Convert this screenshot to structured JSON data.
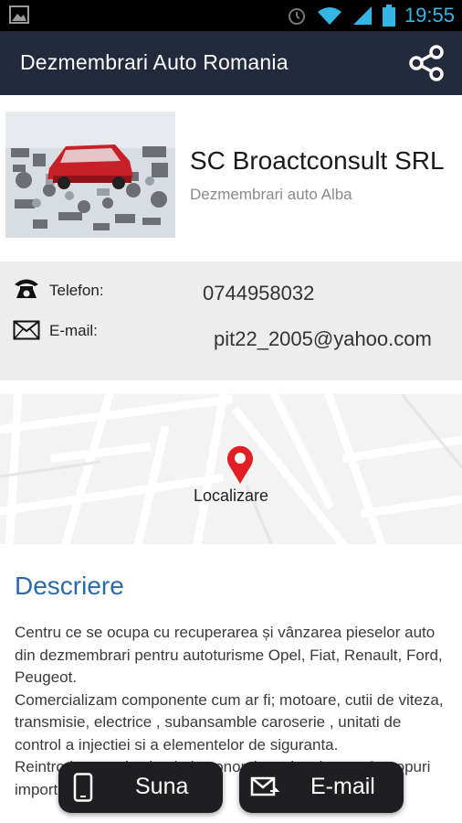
{
  "status_bar": {
    "time": "19:55",
    "icons": [
      "image-icon",
      "alarm-icon",
      "wifi-icon",
      "signal-icon",
      "battery-icon"
    ],
    "accent": "#33b5e5"
  },
  "toolbar": {
    "title": "Dezmembrari Auto Romania",
    "share_icon": "share-icon",
    "background": "#222a3b"
  },
  "business": {
    "name": "SC Broactconsult SRL",
    "subtitle": "Dezmembrari auto Alba"
  },
  "contact": {
    "phone_label": "Telefon:",
    "phone_value": "0744958032",
    "email_label": "E-mail:",
    "email_value": "pit22_2005@yahoo.com"
  },
  "map": {
    "label": "Localizare",
    "pin_color": "#e31e24"
  },
  "description": {
    "title": "Descriere",
    "text": "Centru ce se ocupa cu recuperarea și vânzarea pieselor auto din dezmembrari pentru autoturisme Opel, Fiat, Renault, Ford, Peugeot.\nComercializam componente cum ar fi; motoare, cutii de viteza, transmisie, electrice , subansamble caroserie , unitati de control a injectiei si a elementelor de siguranta.\nReintroducerea in circuitul economic a pieselor are 2 scopuri importante:"
  },
  "actions": {
    "call_label": "Suna",
    "email_label": "E-mail"
  }
}
